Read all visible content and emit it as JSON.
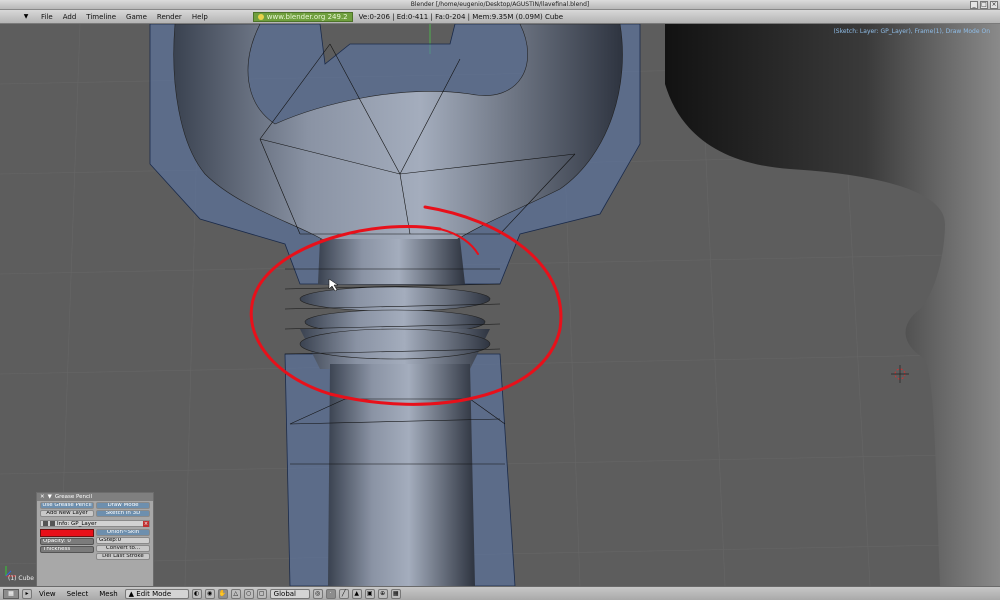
{
  "window": {
    "title": "Blender [/home/eugenio/Desktop/AGUSTIN/llavefinal.blend]"
  },
  "menu": {
    "items": [
      "File",
      "Add",
      "Timeline",
      "Game",
      "Render",
      "Help"
    ],
    "url": "www.blender.org 249.2",
    "stats": "Ve:0-206 | Ed:0-411 | Fa:0-204 | Mem:9.35M (0.09M) Cube"
  },
  "viewport": {
    "info": "(Sketch: Layer: GP_Layer), Frame(1), Draw Mode On",
    "object_label": "(1) Cube",
    "stroke_color": "#e8101a",
    "background": "#5d5d5d"
  },
  "grease_pencil": {
    "title": "Grease Pencil",
    "use_label": "Use Grease Pencil",
    "draw_mode_label": "Draw Mode",
    "add_layer_label": "Add New Layer",
    "sketch_3d_label": "Sketch in 3D",
    "layer_name": "Info: GP_Layer",
    "onion_skin_label": "Onion~Skin",
    "opacity_label": "Opacity: 0",
    "gstep_label": "GStep:0",
    "thickness_label": "Thickness",
    "convert_label": "Convert to...",
    "del_last_label": "Del Last Stroke",
    "color": "#e8101a"
  },
  "bottom": {
    "menu": [
      "View",
      "Select",
      "Mesh"
    ],
    "mode": "Edit Mode",
    "orientation": "Global"
  }
}
